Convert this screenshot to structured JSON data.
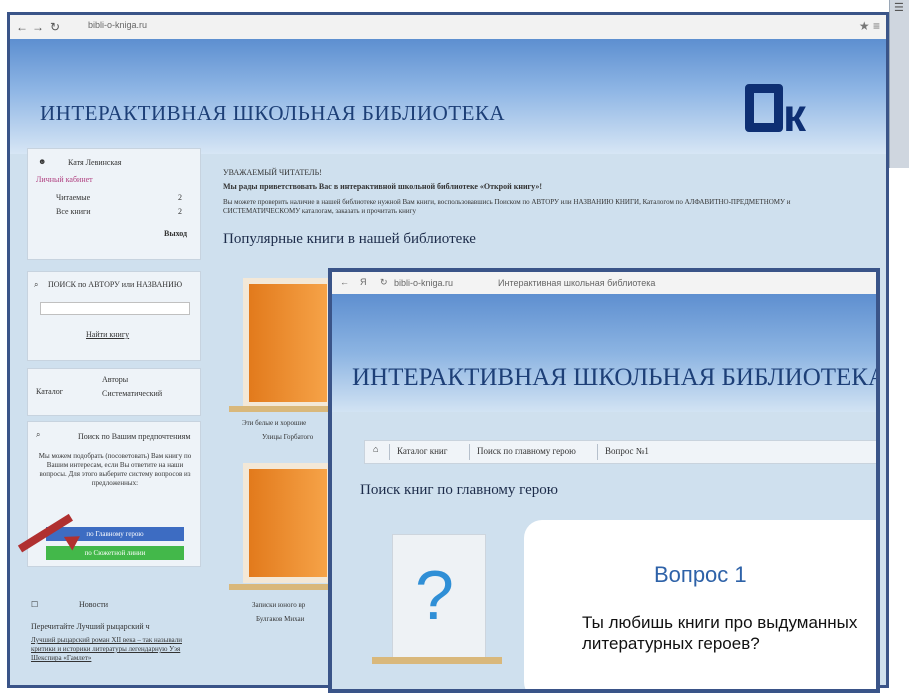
{
  "window1": {
    "address": "bibli-o-kniga.ru",
    "banner_title": "ИНТЕРАКТИВНАЯ ШКОЛЬНАЯ БИБЛИОТЕКА",
    "user": {
      "name": "Катя Левинская",
      "cabinet": "Личный кабинет",
      "reading_label": "Читаемые",
      "reading_count": "2",
      "all_label": "Все книги",
      "all_count": "2",
      "logout": "Выход"
    },
    "search": {
      "label": "ПОИСК по АВТОРУ или НАЗВАНИЮ",
      "button": "Найти книгу"
    },
    "catalog": {
      "label": "Каталог",
      "author": "Авторы",
      "systematic": "Систематический"
    },
    "ask": {
      "label": "Поиск по Вашим предпочтениям",
      "text": "Мы можем подобрать (посоветовать) Вам книгу по Вашим интересам, если Вы ответите на наши вопросы. Для этого выберите систему вопросов из предложенных:",
      "btn_hero": "по Главному герою",
      "btn_story": "по Сюжетной линии"
    },
    "news": {
      "label": "Новости",
      "subtitle": "Перечитайте Лучший рыцарский ч",
      "link": "Лучший рыцарский роман XII века – так называли критики и историки литературы легендарную Уэя Шекспира «Гамлет»"
    },
    "greeting": "УВАЖАЕМЫЙ ЧИТАТЕЛЬ!",
    "welcome": "Мы рады приветствовать Вас в интерактивной школьной библиотеке «Открой книгу»!",
    "intro": "Вы можете проверить наличие в нашей библиотеке нужной Вам книги, воспользовавшись Поиском по АВТОРУ или НАЗВАНИЮ КНИГИ, Каталогом по АЛФАВИТНО-ПРЕДМЕТНОМУ и СИСТЕМАТИЧЕСКОМУ каталогам, заказать и прочитать книгу",
    "popular": "Популярные книги в нашей библиотеке",
    "book1_caption": "Эти белые и хорошие",
    "book1_author": "Улицы Горбатого",
    "book2_caption": "Записки юного вр",
    "book2_author": "Булгаков Михаи"
  },
  "window2": {
    "address": "bibli-o-kniga.ru",
    "page_title": "Интерактивная школьная библиотека",
    "banner_title": "ИНТЕРАКТИВНАЯ ШКОЛЬНАЯ БИБЛИОТЕКА",
    "breadcrumbs": [
      "Каталог книг",
      "Поиск по главному герою",
      "Вопрос №1"
    ],
    "search_title": "Поиск книг по главному герою",
    "question_title": "Вопрос 1",
    "question_text": "Ты любишь книги про выдуманных литературных героев?"
  }
}
